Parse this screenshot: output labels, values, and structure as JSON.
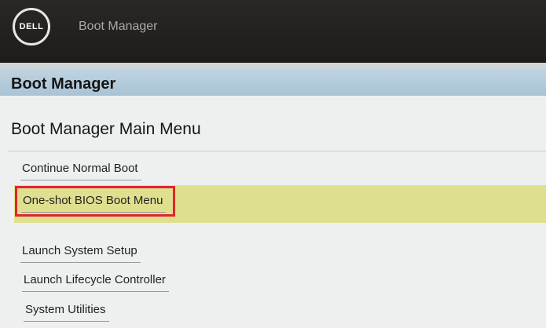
{
  "header": {
    "logo_text": "DELL",
    "title": "Boot Manager"
  },
  "page": {
    "section_title": "Boot Manager",
    "subtitle": "Boot Manager Main Menu"
  },
  "menu": {
    "items": [
      {
        "label": "Continue Normal Boot",
        "selected": false
      },
      {
        "label": "One-shot BIOS Boot Menu",
        "selected": true
      },
      {
        "label": "Launch System Setup",
        "selected": false
      },
      {
        "label": "Launch Lifecycle Controller",
        "selected": false
      },
      {
        "label": "System Utilities",
        "selected": false
      }
    ]
  },
  "colors": {
    "highlight": "#dfe08f",
    "selection_outline": "#e0262b",
    "header_band": "#b4cbdb"
  }
}
